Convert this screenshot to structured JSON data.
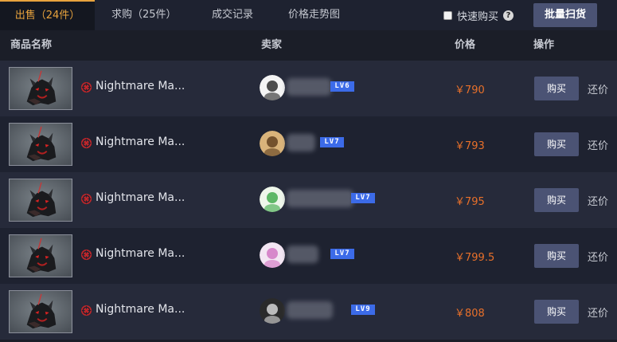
{
  "tabs": [
    {
      "label": "出售（24件）"
    },
    {
      "label": "求购（25件）"
    },
    {
      "label": "成交记录"
    },
    {
      "label": "价格走势图"
    }
  ],
  "toolbar": {
    "quick_buy_label": "快速购买",
    "help_glyph": "?",
    "batch_label": "批量扫货"
  },
  "columns": {
    "name": "商品名称",
    "seller": "卖家",
    "price": "价格",
    "action": "操作"
  },
  "colors": {
    "accent_tab": "#e8a33d",
    "price": "#e8702a",
    "button": "#4b5374",
    "level_badge": "#3c6be8"
  },
  "rows": [
    {
      "item_name": "Nightmare Ma...",
      "level": "LV6",
      "price": "￥790",
      "buy": "购买",
      "bargain": "还价",
      "avatar_icon": "cartoon-face-avatar"
    },
    {
      "item_name": "Nightmare Ma...",
      "level": "LV7",
      "price": "￥793",
      "buy": "购买",
      "bargain": "还价",
      "avatar_icon": "dog-avatar"
    },
    {
      "item_name": "Nightmare Ma...",
      "level": "LV7",
      "price": "￥795",
      "buy": "购买",
      "bargain": "还价",
      "avatar_icon": "green-hair-avatar"
    },
    {
      "item_name": "Nightmare Ma...",
      "level": "LV7",
      "price": "￥799.5",
      "buy": "购买",
      "bargain": "还价",
      "avatar_icon": "pink-anime-avatar"
    },
    {
      "item_name": "Nightmare Ma...",
      "level": "LV9",
      "price": "￥808",
      "buy": "购买",
      "bargain": "还价",
      "avatar_icon": "dark-face-avatar"
    }
  ]
}
